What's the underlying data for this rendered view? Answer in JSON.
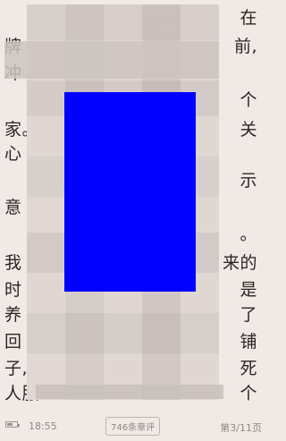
{
  "content": {
    "line1_right": "在",
    "line2_left": "牌",
    "line2_right": "前,",
    "line3_left": "冲",
    "line4_right": "个",
    "line5_left": "家。",
    "line5_right": "关",
    "line6_left": "心",
    "line7_right": "示",
    "line8_left": "意",
    "line9_right": "。",
    "line10_left": "我",
    "line10_right": "来的",
    "line11_left": "时",
    "line11_right": "是",
    "line12_left": "养",
    "line12_right": "了",
    "line13_left": "回",
    "line13_right": "铺",
    "line14_left": "子,",
    "line14_right": "死",
    "line15_left": "人服",
    "line15_right": "个"
  },
  "status_bar": {
    "time": "18:55",
    "comments": "746条章评",
    "page": "第3/11页"
  },
  "colors": {
    "background": "#f1e9e6",
    "overlay_panel": "#0000ff"
  }
}
